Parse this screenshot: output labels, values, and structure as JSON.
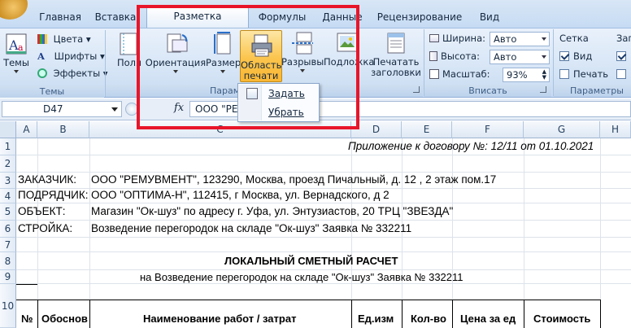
{
  "tabs": [
    "Главная",
    "Вставка",
    "Разметка страницы",
    "Формулы",
    "Данные",
    "Рецензирование",
    "Вид"
  ],
  "ribbon": {
    "themes": {
      "big_label": "Темы",
      "colors": "Цвета",
      "fonts": "Шрифты",
      "effects": "Эффекты",
      "group_label": "Темы"
    },
    "page_setup": {
      "margins_label": "Поля",
      "orientation_label": "Ориентация",
      "size_label": "Размер",
      "print_area_label_1": "Область",
      "print_area_label_2": "печати",
      "breaks_label": "Разрывы",
      "background_label": "Подложка",
      "print_titles_label_1": "Печатать",
      "print_titles_label_2": "заголовки",
      "group_label": "Парам"
    },
    "fit": {
      "width_label": "Ширина:",
      "width_value": "Авто",
      "height_label": "Высота:",
      "height_value": "Авто",
      "scale_label": "Масштаб:",
      "scale_value": "93%",
      "group_label": "Вписать"
    },
    "sheet_options": {
      "gridlines_label": "Сетка",
      "view_label": "Вид",
      "print_label": "Печать",
      "headings_short": "Заг",
      "group_label": "Параметры ли"
    }
  },
  "menu": {
    "set_label": "Задать",
    "clear_label": "Убрать"
  },
  "formula_bar": {
    "cell_ref": "D47",
    "fx": "fx",
    "value": "ООО \"РЕ"
  },
  "columns": [
    "A",
    "B",
    "C",
    "D",
    "E",
    "F",
    "G",
    "H"
  ],
  "rows": [
    "1",
    "2",
    "3",
    "4",
    "5",
    "6",
    "7",
    "8",
    "9",
    "10"
  ],
  "sheet": {
    "appendix": "Приложение к договору №: 12/11 от 01.10.2021",
    "r3_label": "ЗАКАЗЧИК:",
    "r3_value": "ООО \"РЕМУВМЕНТ\", 123290, Москва, проезд Пичальный, д. 12 , 2 этаж пом.17",
    "r4_label": "ПОДРЯДЧИК:",
    "r4_value": "ООО \"ОПТИМА-Н\", 112415, г Москва, ул. Вернадского,  д 2",
    "r5_label": "ОБЪЕКТ:",
    "r5_value": "Магазин \"Ок-шуз\" по адресу г. Уфа, ул. Энтузиастов, 20 ТРЦ \"ЗВЕЗДА\"",
    "r6_label": "СТРОЙКА:",
    "r6_value": "Возведение перегородок на складе \"Ок-шуз\" Заявка № 332211",
    "title": "ЛОКАЛЬНЫЙ СМЕТНЫЙ РАСЧЕТ",
    "subtitle": "на Возведение перегородок на складе \"Ок-шуз\" Заявка № 332211",
    "headers": [
      "№",
      "Обоснов",
      "Наименование работ / затрат",
      "Ед.изм",
      "Кол-во",
      "Цена за ед",
      "Стоимость"
    ]
  }
}
